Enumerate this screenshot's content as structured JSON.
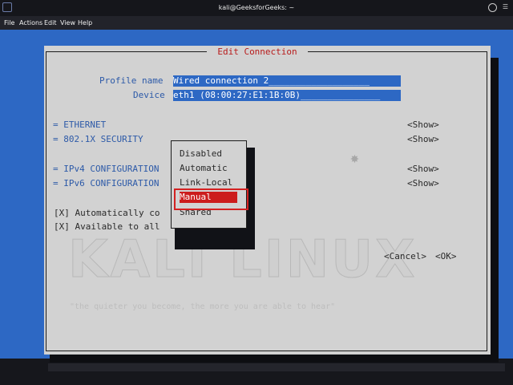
{
  "window": {
    "title": "kali@GeeksforGeeks: ~"
  },
  "menubar": {
    "items": [
      "File",
      "Actions",
      "Edit",
      "View",
      "Help"
    ]
  },
  "dialog": {
    "title": "Edit Connection",
    "profile_label": "Profile name",
    "profile_value": "Wired connection 2",
    "device_label": "Device",
    "device_value": "eth1 (08:00:27:E1:1B:0B)",
    "sections": [
      {
        "label": "= ETHERNET",
        "action": "<Show>"
      },
      {
        "label": "= 802.1X SECURITY",
        "action": "<Show>"
      },
      {
        "label": "= IPv4 CONFIGURATION",
        "action": "<Show>"
      },
      {
        "label": "= IPv6 CONFIGURATION",
        "action": "<Show>"
      }
    ],
    "checkboxes": [
      {
        "text": "[X] Automatically co",
        "checked": true
      },
      {
        "text": "[X] Available to all",
        "checked": true
      }
    ],
    "cancel_label": "<Cancel>",
    "ok_label": "<OK>"
  },
  "popup": {
    "options": [
      "Disabled",
      "Automatic",
      "Link-Local",
      "Manual",
      "Shared"
    ],
    "selected": "Manual"
  },
  "background": {
    "watermark": "KALI LINUX",
    "motto": "\"the quieter you become, the more you are able to hear\""
  },
  "colors": {
    "terminal_bg": "#2d68c4",
    "dialog_bg": "#d2d2d2",
    "title_red": "#b81b1b",
    "selection_red": "#cc1c1c",
    "highlight_box": "#d42121"
  },
  "icons": [
    "terminal-window-icon",
    "close-icon",
    "menu-icon",
    "kali-dragon-icon"
  ]
}
